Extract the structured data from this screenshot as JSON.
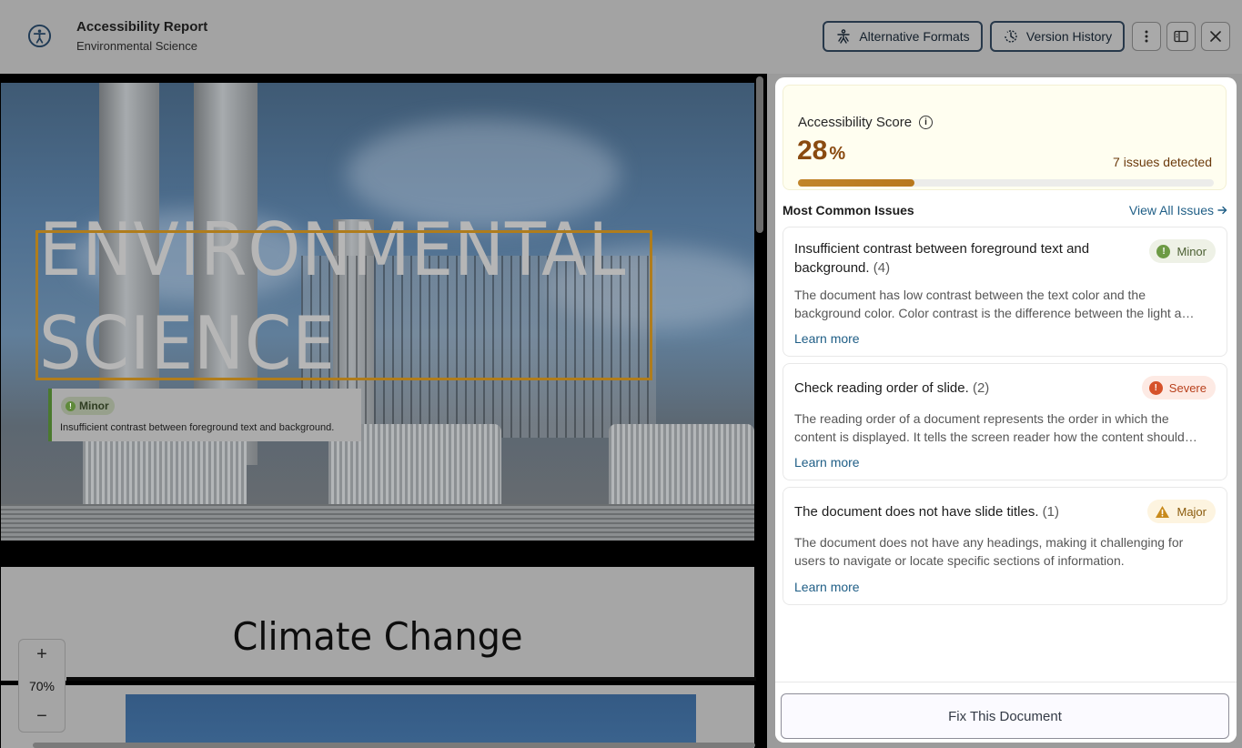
{
  "header": {
    "title": "Accessibility Report",
    "subtitle": "Environmental Science",
    "app_icon": "accessibility-icon",
    "buttons": {
      "alternative_formats": "Alternative Formats",
      "version_history": "Version History"
    },
    "icons": [
      "more-vertical-icon",
      "panel-toggle-icon",
      "close-icon"
    ]
  },
  "preview": {
    "slide1": {
      "title_line1": "ENVIRONMENTAL",
      "title_line2": "SCIENCE",
      "tooltip": {
        "severity": "Minor",
        "text": "Insufficient contrast between foreground text and background."
      }
    },
    "slide2": {
      "title": "Climate Change"
    },
    "zoom": {
      "plus": "+",
      "value": "70%",
      "minus": "−"
    }
  },
  "panel": {
    "score": {
      "label": "Accessibility Score",
      "value": "28",
      "unit": "%",
      "fraction": 0.28,
      "issues_detected": "7 issues detected"
    },
    "common_issues_title": "Most Common Issues",
    "view_all": "View All Issues",
    "issues": [
      {
        "title": "Insufficient contrast between foreground text and background.",
        "count": "(4)",
        "severity": "Minor",
        "description": "The document has low contrast between the text color and the background color. Color contrast is the difference between the light and dark parts of the content.",
        "learn_more": "Learn more"
      },
      {
        "title": "Check reading order of slide.",
        "count": "(2)",
        "severity": "Severe",
        "description": "The reading order of a document represents the order in which the content is displayed. It tells the screen reader how the content should be read.",
        "learn_more": "Learn more"
      },
      {
        "title": "The document does not have slide titles.",
        "count": "(1)",
        "severity": "Major",
        "description": "The document does not have any headings, making it challenging for users to navigate or locate specific sections of information.",
        "learn_more": "Learn more"
      }
    ],
    "fix_button": "Fix This Document"
  },
  "colors": {
    "accent_link": "#1f5e86",
    "score": "#8a4a10",
    "minor": "#4b5f32",
    "severe": "#b8401c",
    "major": "#8a5a0c",
    "highlight_border": "#b07d1c"
  }
}
